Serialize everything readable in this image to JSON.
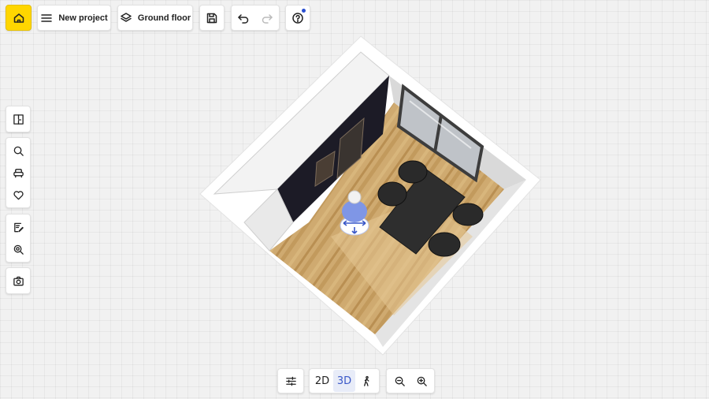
{
  "toolbar": {
    "new_project_label": "New project",
    "floor_label": "Ground floor"
  },
  "view_modes": {
    "mode_2d": "2D",
    "mode_3d": "3D",
    "active": "3D"
  },
  "colors": {
    "home_button": "#ffd600",
    "active_view": "#3a58c8",
    "help_notification_dot": "#2a4fd0",
    "floor_wood": "#c9a66b",
    "cabinet_dark": "#1c1b26",
    "wall_white": "#ffffff",
    "character_blue": "#7f96e6"
  },
  "icons": {
    "home": "home-icon",
    "menu": "menu-icon",
    "layers": "layers-icon",
    "save": "save-icon",
    "undo": "undo-icon",
    "redo": "redo-icon",
    "help": "help-icon",
    "floor_plan": "floor-plan-icon",
    "search": "search-icon",
    "furniture": "armchair-icon",
    "favorites": "heart-icon",
    "notes": "edit-note-icon",
    "render": "render-icon",
    "camera": "camera-icon",
    "settings": "sliders-icon",
    "walk": "walk-icon",
    "zoom_out": "zoom-out-icon",
    "zoom_in": "zoom-in-icon"
  }
}
